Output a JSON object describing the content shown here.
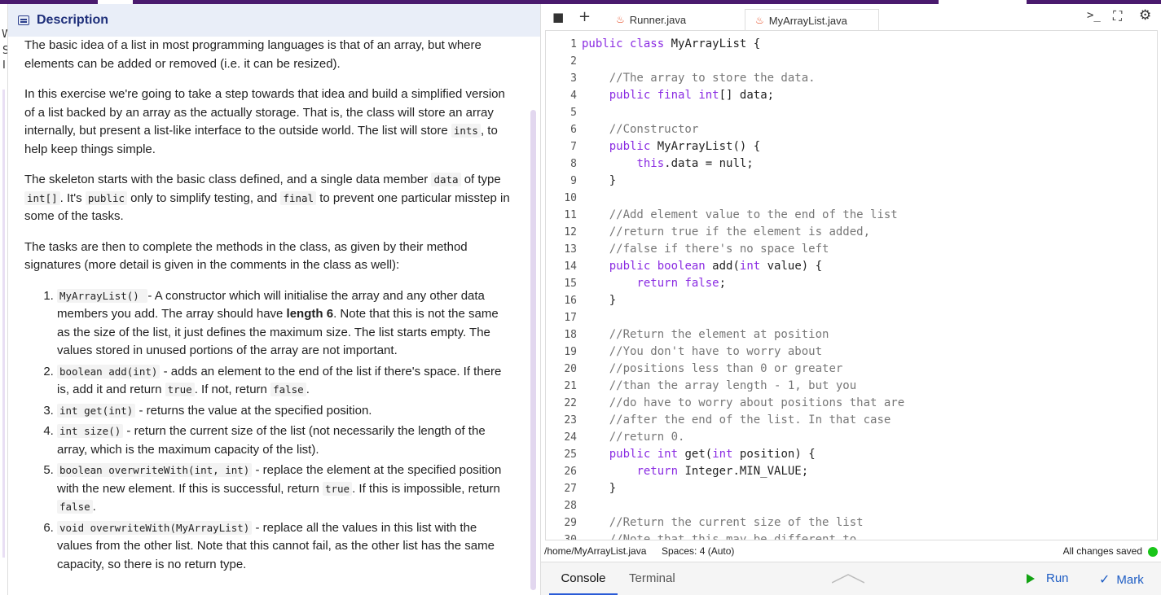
{
  "sliver": {
    "c1": "W",
    "c2": "S",
    "c3": "I"
  },
  "description": {
    "title": "Description",
    "p1": "The basic idea of a list in most programming languages is that of an array, but where elements can be added or removed (i.e. it can be resized).",
    "p2a": "In this exercise we're going to take a step towards that idea and build a simplified version of a list backed by an array as the actually storage. That is, the class will store an array internally, but present a list-like interface to the outside world. The list will store ",
    "p2code": "ints",
    "p2b": ", to help keep things simple.",
    "p3a": "The skeleton starts with the basic class defined, and a single data member ",
    "p3code1": "data",
    "p3b": " of type ",
    "p3code2": "int[]",
    "p3c": ". It's ",
    "p3code3": "public",
    "p3d": " only to simplify testing, and ",
    "p3code4": "final",
    "p3e": " to prevent one particular misstep in some of the tasks.",
    "p4": "The tasks are then to complete the methods in the class, as given by their method signatures (more detail is given in the comments in the class as well):",
    "items": [
      {
        "code": "MyArrayList() ",
        "a": " - A constructor which will initialise the array and any other data members you add. The array should have ",
        "bold": "length 6",
        "b": ". Note that this is not the same as the size of the list, it just defines the maximum size. The list starts empty. The values stored in unused portions of the array are not important."
      },
      {
        "code": "boolean add(int)",
        "a": " - adds an element to the end of the list if there's space. If there is, add it and return ",
        "code2": "true",
        "b": ". If not, return ",
        "code3": "false",
        "c": "."
      },
      {
        "code": "int get(int)",
        "a": " - returns the value at the specified position."
      },
      {
        "code": "int size()",
        "a": " - return the current size of the list (not necessarily the length of the array, which is the maximum capacity of the list)."
      },
      {
        "code": "boolean overwriteWith(int, int)",
        "a": " - replace the element at the specified position with the new element. If this is successful, return ",
        "code2": "true",
        "b": ". If this is impossible, return ",
        "code3": "false",
        "c": "."
      },
      {
        "code": "void overwriteWith(MyArrayList)",
        "a": " - replace all the values in this list with the values from the other list. Note that this cannot fail, as the other list has the same capacity, so there is no return type."
      }
    ]
  },
  "editor": {
    "tabs": [
      {
        "label": "Runner.java",
        "active": false
      },
      {
        "label": "MyArrayList.java",
        "active": true
      }
    ],
    "icons": {
      "files": "folder-icon",
      "add": "plus-icon",
      "terminal": "terminal-icon",
      "fullscreen": "fullscreen-icon",
      "settings": "gear-icon"
    },
    "lines": [
      {
        "n": "1",
        "t": "public class MyArrayList {"
      },
      {
        "n": "2",
        "t": ""
      },
      {
        "n": "3",
        "t": "    //The array to store the data."
      },
      {
        "n": "4",
        "t": "    public final int[] data;"
      },
      {
        "n": "5",
        "t": ""
      },
      {
        "n": "6",
        "t": "    //Constructor"
      },
      {
        "n": "7",
        "t": "    public MyArrayList() {"
      },
      {
        "n": "8",
        "t": "        this.data = null;"
      },
      {
        "n": "9",
        "t": "    }"
      },
      {
        "n": "10",
        "t": ""
      },
      {
        "n": "11",
        "t": "    //Add element value to the end of the list"
      },
      {
        "n": "12",
        "t": "    //return true if the element is added,"
      },
      {
        "n": "13",
        "t": "    //false if there's no space left"
      },
      {
        "n": "14",
        "t": "    public boolean add(int value) {"
      },
      {
        "n": "15",
        "t": "        return false;"
      },
      {
        "n": "16",
        "t": "    }"
      },
      {
        "n": "17",
        "t": ""
      },
      {
        "n": "18",
        "t": "    //Return the element at position"
      },
      {
        "n": "19",
        "t": "    //You don't have to worry about"
      },
      {
        "n": "20",
        "t": "    //positions less than 0 or greater"
      },
      {
        "n": "21",
        "t": "    //than the array length - 1, but you"
      },
      {
        "n": "22",
        "t": "    //do have to worry about positions that are"
      },
      {
        "n": "23",
        "t": "    //after the end of the list. In that case"
      },
      {
        "n": "24",
        "t": "    //return 0."
      },
      {
        "n": "25",
        "t": "    public int get(int position) {"
      },
      {
        "n": "26",
        "t": "        return Integer.MIN_VALUE;"
      },
      {
        "n": "27",
        "t": "    }"
      },
      {
        "n": "28",
        "t": ""
      },
      {
        "n": "29",
        "t": "    //Return the current size of the list"
      },
      {
        "n": "30",
        "t": "    //Note that this may be different to"
      }
    ],
    "status": {
      "path": "/home/MyArrayList.java",
      "spaces": "Spaces: 4 (Auto)",
      "saved": "All changes saved"
    },
    "bottom": {
      "console": "Console",
      "terminal": "Terminal",
      "run": "Run",
      "mark": "Mark"
    }
  }
}
